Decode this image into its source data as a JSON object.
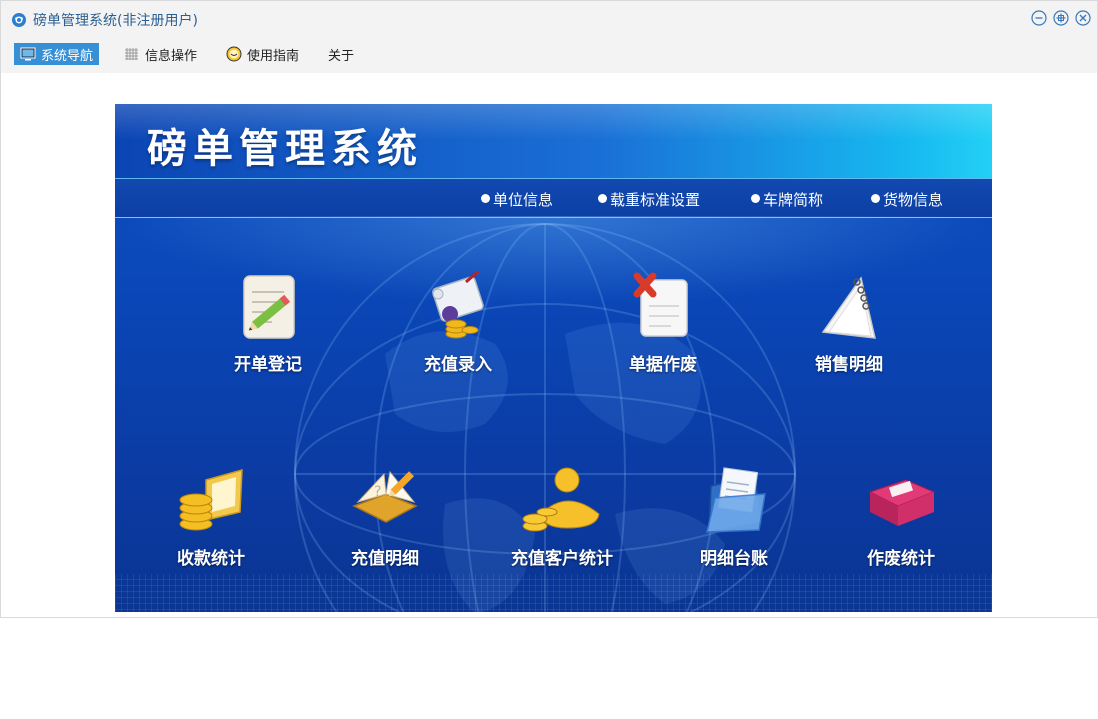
{
  "window": {
    "title": "磅单管理系统(非注册用户)",
    "controls": [
      "minimize-icon",
      "maximize-icon",
      "close-icon"
    ]
  },
  "menu": {
    "items": [
      {
        "label": "系统导航",
        "icon": "monitor-icon",
        "active": true
      },
      {
        "label": "信息操作",
        "icon": "grid-icon",
        "active": false
      },
      {
        "label": "使用指南",
        "icon": "smiley-icon",
        "active": false
      },
      {
        "label": "关于",
        "icon": "",
        "active": false
      }
    ]
  },
  "banner": {
    "logo": "磅单管理系统",
    "nav_links": [
      "单位信息",
      "载重标准设置",
      "车牌简称",
      "货物信息"
    ]
  },
  "tiles": [
    {
      "label": "开单登记",
      "icon": "notepad-pencil-icon"
    },
    {
      "label": "充值录入",
      "icon": "scroll-coins-icon"
    },
    {
      "label": "单据作废",
      "icon": "document-x-icon"
    },
    {
      "label": "销售明细",
      "icon": "spiral-notebook-icon"
    },
    {
      "label": "收款统计",
      "icon": "coins-laptop-icon"
    },
    {
      "label": "充值明细",
      "icon": "book-pencil-icon"
    },
    {
      "label": "充值客户统计",
      "icon": "gold-person-coins-icon"
    },
    {
      "label": "明细台账",
      "icon": "folder-documents-icon"
    },
    {
      "label": "作废统计",
      "icon": "red-box-icon"
    }
  ],
  "colors": {
    "title_text": "#2b5f94",
    "active_menu": "#3790d6",
    "banner_blue": "#0b45b4",
    "banner_cyan": "#22d0f5"
  }
}
